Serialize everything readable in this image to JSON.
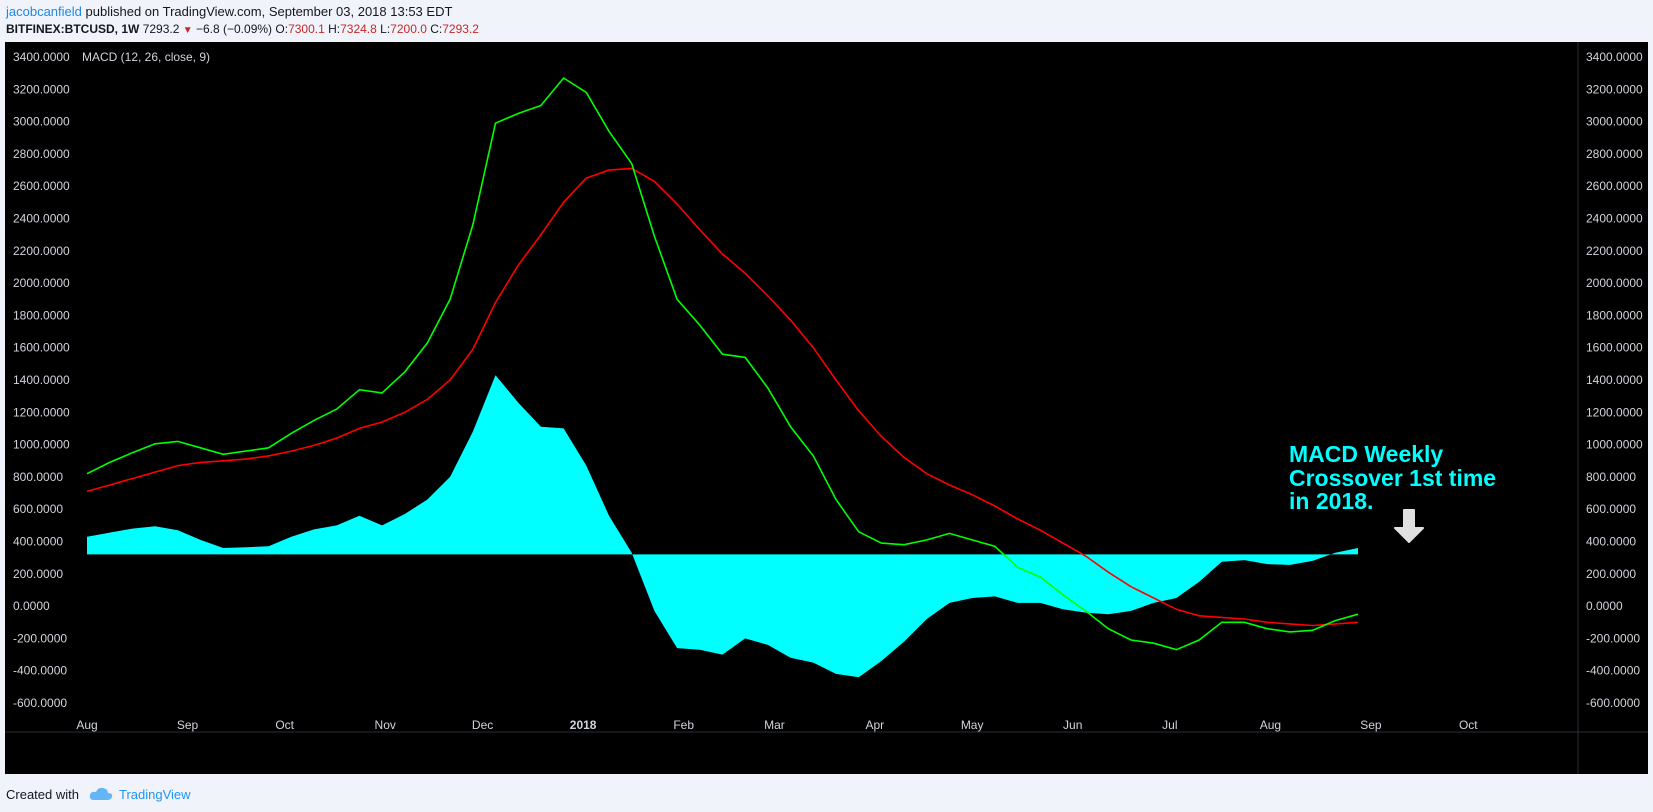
{
  "header": {
    "author": "jacobcanfield",
    "published": "published on TradingView.com, September 03, 2018 13:53 EDT",
    "symbol": "BITFINEX:BTCUSD, 1W",
    "last": "7293.2",
    "change": "−6.8 (−0.09%)",
    "o_label": "O:",
    "o_value": "7300.1",
    "h_label": "H:",
    "h_value": "7324.8",
    "l_label": "L:",
    "l_value": "7200.0",
    "c_label": "C:",
    "c_value": "7293.2"
  },
  "footer": {
    "created_with": "Created with",
    "brand": "TradingView",
    "logo_icon": "tradingview-cloud-icon"
  },
  "colors": {
    "background": "#000000",
    "macd": "#00ff00",
    "signal": "#ff0000",
    "histogram": "#00ffff",
    "axis_text": "#d1d4dc",
    "annotation": "#00ffff",
    "arrow": "#e0e0e0"
  },
  "chart_data": {
    "type": "line",
    "title": "MACD (12, 26, close, 9)",
    "xlabel": "",
    "ylabel": "",
    "ylim": [
      -650,
      3450
    ],
    "yticks": [
      "3400.0000",
      "3200.0000",
      "3000.0000",
      "2800.0000",
      "2600.0000",
      "2400.0000",
      "2200.0000",
      "2000.0000",
      "1800.0000",
      "1600.0000",
      "1400.0000",
      "1200.0000",
      "1000.0000",
      "800.0000",
      "600.0000",
      "400.0000",
      "200.0000",
      "0.0000",
      "-200.0000",
      "-400.0000",
      "-600.0000"
    ],
    "xticks": [
      {
        "label": "Aug",
        "t": 0.0,
        "bold": false
      },
      {
        "label": "Sep",
        "t": 4.43,
        "bold": false
      },
      {
        "label": "Oct",
        "t": 8.71,
        "bold": false
      },
      {
        "label": "Nov",
        "t": 13.14,
        "bold": false
      },
      {
        "label": "Dec",
        "t": 17.43,
        "bold": false
      },
      {
        "label": "2018",
        "t": 21.86,
        "bold": true
      },
      {
        "label": "Feb",
        "t": 26.29,
        "bold": false
      },
      {
        "label": "Mar",
        "t": 30.29,
        "bold": false
      },
      {
        "label": "Apr",
        "t": 34.71,
        "bold": false
      },
      {
        "label": "May",
        "t": 39.0,
        "bold": false
      },
      {
        "label": "Jun",
        "t": 43.43,
        "bold": false
      },
      {
        "label": "Jul",
        "t": 47.71,
        "bold": false
      },
      {
        "label": "Aug",
        "t": 52.14,
        "bold": false
      },
      {
        "label": "Sep",
        "t": 56.57,
        "bold": false
      },
      {
        "label": "Oct",
        "t": 60.86,
        "bold": false
      }
    ],
    "xlim": [
      -2.6,
      64.9
    ],
    "histogram_baseline": 320,
    "series": [
      {
        "name": "MACD",
        "color": "#00ff00",
        "values": [
          820,
          890,
          950,
          1005,
          1020,
          980,
          940,
          960,
          980,
          1070,
          1150,
          1220,
          1340,
          1320,
          1450,
          1630,
          1900,
          2360,
          2990,
          3050,
          3100,
          3270,
          3180,
          2940,
          2740,
          2290,
          1900,
          1740,
          1560,
          1540,
          1350,
          1110,
          930,
          660,
          460,
          390,
          380,
          410,
          450,
          410,
          370,
          240,
          180,
          70,
          -30,
          -140,
          -210,
          -230,
          -270,
          -210,
          -100,
          -100,
          -140,
          -160,
          -150,
          -90,
          -50
        ]
      },
      {
        "name": "Signal",
        "color": "#ff0000",
        "values": [
          710,
          750,
          790,
          830,
          870,
          890,
          900,
          910,
          930,
          960,
          995,
          1040,
          1100,
          1140,
          1200,
          1280,
          1400,
          1590,
          1880,
          2110,
          2300,
          2500,
          2650,
          2700,
          2710,
          2630,
          2490,
          2330,
          2180,
          2060,
          1920,
          1770,
          1600,
          1400,
          1210,
          1050,
          920,
          820,
          750,
          690,
          620,
          540,
          470,
          390,
          310,
          210,
          120,
          50,
          -20,
          -60,
          -70,
          -80,
          -100,
          -110,
          -120,
          -110,
          -100
        ]
      },
      {
        "name": "Histogram",
        "color": "#00ffff",
        "values": [
          430,
          455,
          480,
          495,
          470,
          410,
          360,
          365,
          370,
          430,
          475,
          500,
          560,
          500,
          570,
          660,
          800,
          1080,
          1430,
          1260,
          1110,
          1100,
          870,
          560,
          330,
          -30,
          -260,
          -270,
          -300,
          -200,
          -240,
          -320,
          -350,
          -420,
          -440,
          -340,
          -220,
          -80,
          20,
          50,
          60,
          20,
          20,
          -20,
          -40,
          -50,
          -30,
          20,
          50,
          150,
          275,
          285,
          260,
          255,
          280,
          330,
          360
        ]
      }
    ],
    "annotations": [
      {
        "text_lines": [
          "MACD Weekly",
          "Crossover 1st time",
          "in 2018."
        ]
      }
    ],
    "arrow_icon": "down-arrow-icon",
    "grid": false,
    "legend": "none"
  }
}
